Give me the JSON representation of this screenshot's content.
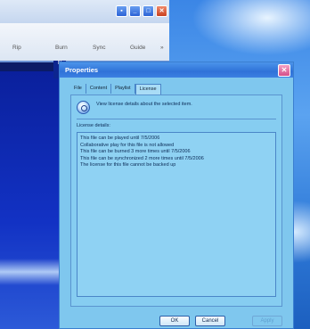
{
  "player": {
    "menu": [
      "Rip",
      "Burn",
      "Sync",
      "Guide"
    ],
    "more": "»",
    "strip_label": "N"
  },
  "dialog": {
    "title": "Properties",
    "close_glyph": "✕",
    "tabs": [
      "File",
      "Content",
      "Playlist",
      "License"
    ],
    "active_tab": "License",
    "info_text": "View license details about the selected item.",
    "details_label": "License details:",
    "details": [
      "This file can be played until 7/5/2006",
      "Collaborative play for this file is not allowed",
      "This file can be burned 3 more times until 7/5/2006",
      "This file can be synchronized 2 more times until 7/5/2006",
      "The license for this file cannot be backed up"
    ],
    "buttons": {
      "ok": "OK",
      "cancel": "Cancel",
      "apply": "Apply"
    }
  },
  "colors": {
    "dialog_bg": "#7fc7ee",
    "titlebar": "#2f72d8",
    "close_button": "#d4508a"
  }
}
